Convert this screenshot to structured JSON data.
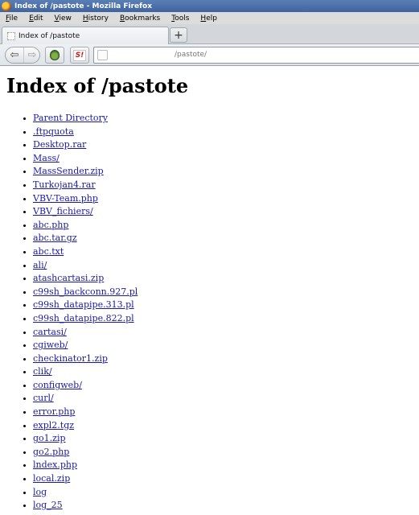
{
  "window": {
    "title": "Index of /pastote - Mozilla Firefox"
  },
  "menu": {
    "items": [
      {
        "label": "File",
        "key": "F",
        "rest": "ile"
      },
      {
        "label": "Edit",
        "key": "E",
        "rest": "dit"
      },
      {
        "label": "View",
        "key": "V",
        "rest": "iew"
      },
      {
        "label": "History",
        "key": "H",
        "rest": "istory"
      },
      {
        "label": "Bookmarks",
        "key": "B",
        "rest": "ookmarks"
      },
      {
        "label": "Tools",
        "key": "T",
        "rest": "ools"
      },
      {
        "label": "Help",
        "key": "H",
        "rest": "elp"
      }
    ]
  },
  "tabs": [
    {
      "title": "Index of /pastote",
      "active": true
    }
  ],
  "new_tab_label": "+",
  "nav": {
    "back_icon": "back-arrow-icon",
    "forward_icon": "forward-arrow-icon",
    "back_glyph": "⇦",
    "forward_glyph": "⇨",
    "addon1_icon": "onion-icon",
    "addon2_label": "S!",
    "url": "/pastote/"
  },
  "page": {
    "heading": "Index of /pastote",
    "entries": [
      "Parent Directory",
      ".ftpquota",
      "Desktop.rar",
      "Mass/",
      "MassSender.zip",
      "Turkojan4.rar",
      "VBV-Team.php",
      "VBV_fichiers/",
      "abc.php",
      "abc.tar.gz",
      "abc.txt",
      "ali/",
      "atashcartasi.zip",
      "c99sh_backconn.927.pl",
      "c99sh_datapipe.313.pl",
      "c99sh_datapipe.822.pl",
      "cartasi/",
      "cgiweb/",
      "checkinator1.zip",
      "clik/",
      "configweb/",
      "curl/",
      "error.php",
      "expl2.tgz",
      "go1.zip",
      "go2.php",
      "lndex.php",
      "local.zip",
      "log",
      "log_25"
    ]
  },
  "colors": {
    "link": "#1a1aa6",
    "titlebar": "#4a6fab"
  }
}
